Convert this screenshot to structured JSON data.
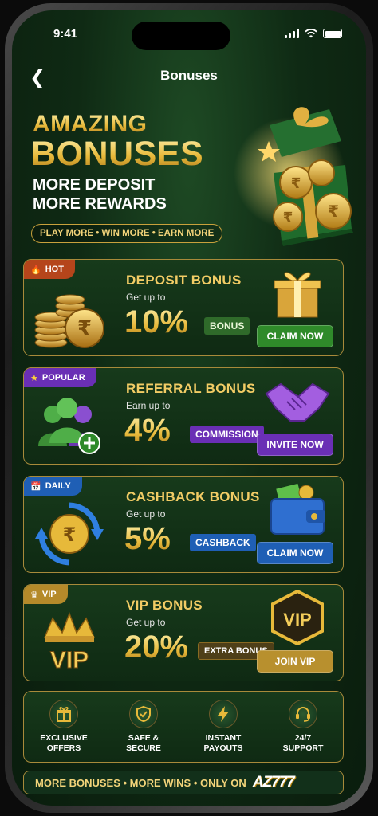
{
  "status": {
    "time": "9:41"
  },
  "nav": {
    "title": "Bonuses",
    "back_icon": "chevron-left-icon"
  },
  "hero": {
    "title_line1": "AMAZING",
    "title_line2": "BONUSES",
    "subtitle_line1": "MORE DEPOSIT",
    "subtitle_line2": "MORE REWARDS",
    "tagline": "PLAY MORE • WIN MORE • EARN MORE"
  },
  "cards": [
    {
      "badge": "HOT",
      "badge_icon": "flame-icon",
      "badge_color": "#b5451b",
      "title": "DEPOSIT BONUS",
      "sub": "Get up to",
      "percent": "10%",
      "tag": "BONUS",
      "tag_bg": "#2f6a2a",
      "tag_color": "#ffffff",
      "cta": "CLAIM NOW",
      "cta_bg": "#2f8a2a"
    },
    {
      "badge": "POPULAR",
      "badge_icon": "star-icon",
      "badge_color": "#6a2fb5",
      "title": "REFERRAL BONUS",
      "sub": "Earn up to",
      "percent": "4%",
      "tag": "COMMISSION",
      "tag_bg": "#6a2fb5",
      "tag_color": "#ffffff",
      "cta": "INVITE NOW",
      "cta_bg": "#6a2fb5"
    },
    {
      "badge": "DAILY",
      "badge_icon": "calendar-icon",
      "badge_color": "#1f5fb5",
      "title": "CASHBACK BONUS",
      "sub": "Get up to",
      "percent": "5%",
      "tag": "CASHBACK",
      "tag_bg": "#1f5fb5",
      "tag_color": "#ffffff",
      "cta": "CLAIM NOW",
      "cta_bg": "#1f5fb5"
    },
    {
      "badge": "VIP",
      "badge_icon": "crown-icon",
      "badge_color": "#b58a2a",
      "title": "VIP BONUS",
      "sub": "Get up to",
      "percent": "20%",
      "tag": "EXTRA BONUS",
      "tag_bg": "#6b5520",
      "tag_color": "#ffffff",
      "cta": "JOIN VIP",
      "cta_bg": "#b8902e"
    }
  ],
  "features": [
    {
      "label": "EXCLUSIVE\nOFFERS",
      "icon": "gift-icon"
    },
    {
      "label": "SAFE &\nSECURE",
      "icon": "shield-check-icon"
    },
    {
      "label": "INSTANT\nPAYOUTS",
      "icon": "lightning-icon"
    },
    {
      "label": "24/7\nSUPPORT",
      "icon": "headset-icon"
    }
  ],
  "footer": {
    "text": "MORE BONUSES • MORE WINS • ONLY ON",
    "logo": "AZ777"
  },
  "colors": {
    "gold": "#e7b93a",
    "bg": "#0f2a14",
    "border": "#a88a3a"
  }
}
